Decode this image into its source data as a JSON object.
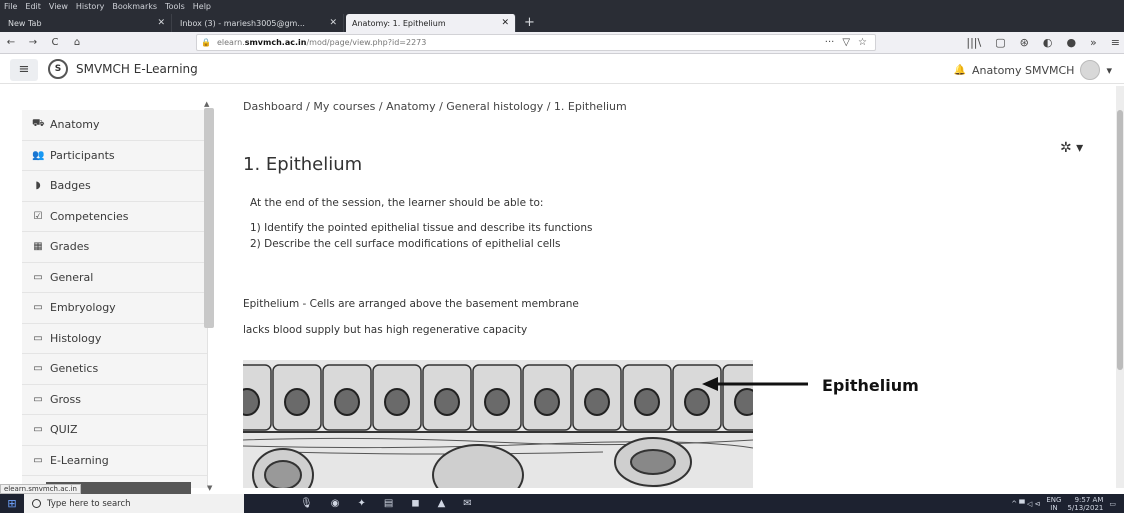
{
  "browser": {
    "menu": [
      "File",
      "Edit",
      "View",
      "History",
      "Bookmarks",
      "Tools",
      "Help"
    ],
    "tabs": [
      {
        "label": "New Tab",
        "close": "✕"
      },
      {
        "label": "Inbox (3) - mariesh3005@gm...",
        "close": "✕"
      },
      {
        "label": "Anatomy: 1. Epithelium",
        "close": "✕"
      }
    ],
    "new_tab": "+",
    "nav": {
      "back": "←",
      "forward": "→",
      "reload": "C",
      "home": "⌂"
    },
    "url": {
      "prefix": "elearn.",
      "domain": "smvmch.ac.in",
      "path": "/mod/page/view.php?id=2273"
    },
    "url_actions": [
      "···",
      "▽",
      "☆"
    ],
    "toolbar_right": [
      "|||\\",
      "▢",
      "⊛",
      "◐",
      "●",
      "»",
      "≡"
    ]
  },
  "site": {
    "menu_icon": "≡",
    "logo_text": "S",
    "name": "SMVMCH E-Learning",
    "user": "Anatomy SMVMCH",
    "bell": "🔔",
    "user_caret": "▾"
  },
  "sidebar": {
    "items": [
      {
        "icon": "⛟",
        "label": "Anatomy"
      },
      {
        "icon": "👥",
        "label": "Participants"
      },
      {
        "icon": "◗",
        "label": "Badges"
      },
      {
        "icon": "☑",
        "label": "Competencies"
      },
      {
        "icon": "▦",
        "label": "Grades"
      },
      {
        "icon": "▭",
        "label": "General"
      },
      {
        "icon": "▭",
        "label": "Embryology"
      },
      {
        "icon": "▭",
        "label": "Histology"
      },
      {
        "icon": "▭",
        "label": "Genetics"
      },
      {
        "icon": "▭",
        "label": "Gross"
      },
      {
        "icon": "▭",
        "label": "QUIZ"
      },
      {
        "icon": "▭",
        "label": "E-Learning"
      }
    ],
    "scroll_up": "▲",
    "scroll_down": "▼"
  },
  "main": {
    "breadcrumb": "Dashboard / My courses / Anatomy / General histology / 1. Epithelium",
    "gear": "✲ ▾",
    "title": "1. Epithelium",
    "intro": "At the end of the session, the learner should be able to:",
    "objectives": [
      "1) Identify the pointed epithelial tissue and describe its functions",
      "2) Describe the cell surface modifications of epithelial cells"
    ],
    "lines": [
      "Epithelium - Cells are arranged above the basement membrane",
      "lacks blood supply but has high regenerative capacity"
    ],
    "image_label": "Epithelium"
  },
  "status_url": "elearn.smvmch.ac.in",
  "taskbar": {
    "start": "⊞",
    "search_placeholder": "Type here to search",
    "icons": [
      "🎙",
      "◉",
      "✦",
      "▤",
      "◼",
      "▲",
      "✉"
    ],
    "tray": "^ ▀ ◁ ⊲",
    "lang_top": "ENG",
    "lang_bottom": "IN",
    "time": "9:57 AM",
    "date": "5/13/2021",
    "notify": "▭"
  }
}
